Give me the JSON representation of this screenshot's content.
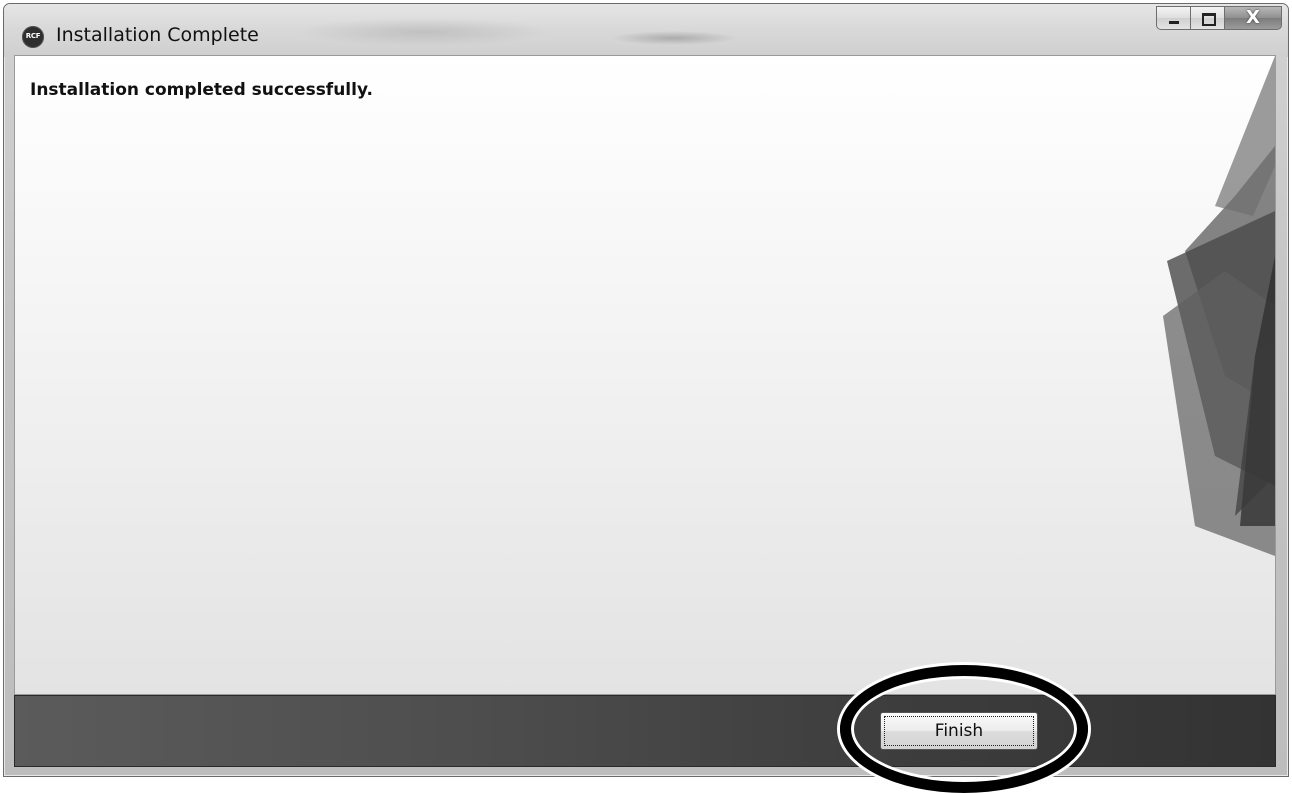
{
  "window": {
    "title": "Installation Complete",
    "app_icon_text": "RCF",
    "close_glyph": "X"
  },
  "content": {
    "message": "Installation completed successfully."
  },
  "footer": {
    "finish_label": "Finish"
  },
  "annotation": {
    "highlight_target": "Finish",
    "ring_color": "#000000"
  }
}
